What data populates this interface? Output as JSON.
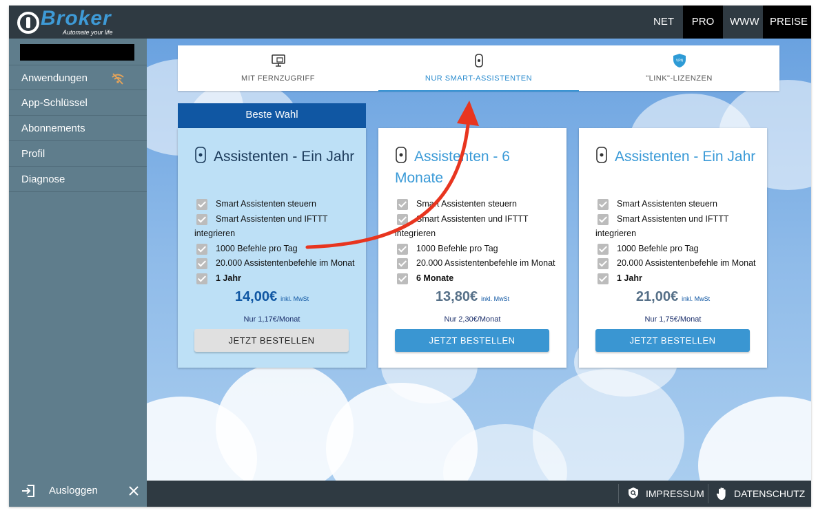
{
  "brand": {
    "name": "Broker",
    "tagline": "Automate your life"
  },
  "topnav": {
    "items": [
      "NET",
      "PRO",
      "WWW",
      "PREISE"
    ]
  },
  "sidebar": {
    "items": [
      {
        "label": "Anwendungen"
      },
      {
        "label": "App-Schlüssel"
      },
      {
        "label": "Abonnements"
      },
      {
        "label": "Profil"
      },
      {
        "label": "Diagnose"
      }
    ],
    "logout_label": "Ausloggen"
  },
  "tabs": [
    {
      "label": "MIT FERNZUGRIFF",
      "icon": "monitor-icon"
    },
    {
      "label": "NUR SMART-ASSISTENTEN",
      "icon": "smart-speaker-icon",
      "active": true
    },
    {
      "label": "\"LINK\"-LIZENZEN",
      "icon": "vpn-shield-icon"
    }
  ],
  "best_choice_label": "Beste Wahl",
  "plans": [
    {
      "title": "Assistenten - Ein Jahr",
      "features": [
        "Smart Assistenten steuern",
        "Smart Assistenten und IFTTT",
        "1000 Befehle pro Tag",
        "20.000 Assistentenbefehle im Monat",
        "1 Jahr"
      ],
      "feature_cont": "integrieren",
      "price": "14,00€",
      "vat": "inkl. MwSt",
      "per_month": "Nur 1,17€/Monat",
      "button": "JETZT BESTELLEN"
    },
    {
      "title": "Assistenten - 6 Monate",
      "features": [
        "Smart Assistenten steuern",
        "Smart Assistenten und IFTTT",
        "1000 Befehle pro Tag",
        "20.000 Assistentenbefehle im Monat",
        "6 Monate"
      ],
      "feature_cont": "integrieren",
      "price": "13,80€",
      "vat": "inkl. MwSt",
      "per_month": "Nur 2,30€/Monat",
      "button": "JETZT BESTELLEN"
    },
    {
      "title": "Assistenten - Ein Jahr",
      "features": [
        "Smart Assistenten steuern",
        "Smart Assistenten und IFTTT",
        "1000 Befehle pro Tag",
        "20.000 Assistentenbefehle im Monat",
        "1 Jahr"
      ],
      "feature_cont": "integrieren",
      "price": "21,00€",
      "vat": "inkl. MwSt",
      "per_month": "Nur 1,75€/Monat",
      "button": "JETZT BESTELLEN"
    }
  ],
  "footer": {
    "impressum": "IMPRESSUM",
    "datenschutz": "DATENSCHUTZ"
  },
  "colors": {
    "accent": "#3a96d2",
    "best_header": "#1057a3",
    "annotation_arrow": "#e8351f",
    "topbar": "#2f3a42"
  }
}
